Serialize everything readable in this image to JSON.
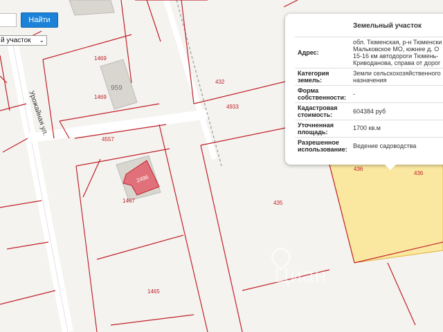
{
  "search": {
    "button_label": "Найти",
    "select_value": "й участок"
  },
  "map": {
    "street_name": "Урожайная ул.",
    "building_numbers": [
      "959",
      "2496"
    ],
    "parcel_numbers": [
      "1469",
      "1469",
      "432",
      "4933",
      "4557",
      "1467",
      "435",
      "436",
      "436",
      "1465"
    ],
    "watermark": "Циан"
  },
  "popup": {
    "title": "Земельный участок",
    "address_key": "Адрес:",
    "address_lines": [
      "обл. Тюменская, р-н Тюменски",
      "Мальковское МО, южнее д. О",
      "15-16 км автодороги Тюмень-",
      "Криводанова, справа от дорог"
    ],
    "category_key_lines": [
      "Категория",
      "земель:"
    ],
    "category_value_lines": [
      "Земли сельскохозяйственного",
      "назначения"
    ],
    "ownership_key_lines": [
      "Форма",
      "собственности:"
    ],
    "ownership_value": "-",
    "cost_key_lines": [
      "Кадастровая",
      "стоимость:"
    ],
    "cost_value": "604384 руб",
    "area_key_lines": [
      "Уточненная",
      "площадь:"
    ],
    "area_value": "1700 кв.м",
    "use_key_lines": [
      "Разрешенное",
      "использование:"
    ],
    "use_value": "Ведение садоводства"
  },
  "colors": {
    "parcel_border": "#c0202a",
    "selected_parcel": "#fbe8a0",
    "button": "#1c82d8",
    "building": "#d9d6cf",
    "building_highlight": "#e0717a"
  }
}
